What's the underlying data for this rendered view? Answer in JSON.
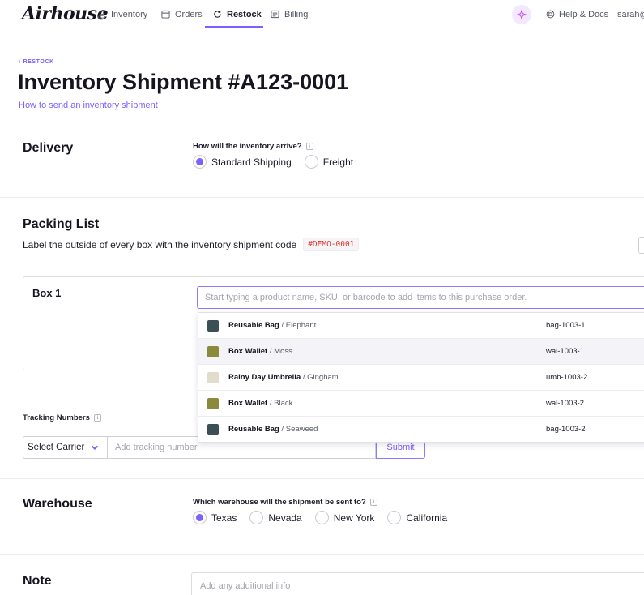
{
  "nav": {
    "logo": "Airhouse",
    "items": [
      {
        "label": "Inventory",
        "icon": "user-icon"
      },
      {
        "label": "Orders",
        "icon": "calendar-icon"
      },
      {
        "label": "Restock",
        "icon": "refresh-icon"
      },
      {
        "label": "Billing",
        "icon": "receipt-icon"
      }
    ],
    "active": "Restock",
    "help": "Help & Docs",
    "user": "sarah@"
  },
  "colors": {
    "accent": "#7b61ff",
    "code_red": "#e0332f",
    "ai_bg": "#f4e8ff"
  },
  "header": {
    "breadcrumb": "‹ RESTOCK",
    "title": "Inventory Shipment #A123-0001",
    "help_link": "How to send an inventory shipment"
  },
  "delivery": {
    "heading": "Delivery",
    "question": "How will the inventory arrive?",
    "options": [
      "Standard Shipping",
      "Freight"
    ],
    "selected": "Standard Shipping"
  },
  "packing": {
    "heading": "Packing List",
    "instruction": "Label the outside of every box with the inventory shipment code",
    "code": "#DEMO-0001",
    "box_title": "Box 1",
    "search_placeholder": "Start typing a product name, SKU, or barcode to add items to this purchase order.",
    "results": [
      {
        "name": "Reusable Bag",
        "variant": "/ Elephant",
        "sku": "bag-1003-1",
        "thumb": "#3c4f55"
      },
      {
        "name": "Box Wallet",
        "variant": "/ Moss",
        "sku": "wal-1003-1",
        "thumb": "#8b8a3c"
      },
      {
        "name": "Rainy Day Umbrella",
        "variant": "/ Gingham",
        "sku": "umb-1003-2",
        "thumb": "#e1dccb"
      },
      {
        "name": "Box Wallet",
        "variant": "/ Black",
        "sku": "wal-1003-2",
        "thumb": "#8b8a3c"
      },
      {
        "name": "Reusable Bag",
        "variant": "/ Seaweed",
        "sku": "bag-1003-2",
        "thumb": "#3c4f55"
      }
    ]
  },
  "tracking": {
    "label": "Tracking Numbers",
    "carrier": "Select Carrier",
    "placeholder": "Add tracking number",
    "submit": "Submit"
  },
  "warehouse": {
    "heading": "Warehouse",
    "question": "Which warehouse will the shipment be sent to?",
    "options": [
      "Texas",
      "Nevada",
      "New York",
      "California"
    ],
    "selected": "Texas"
  },
  "note": {
    "heading": "Note",
    "placeholder": "Add any additional info"
  }
}
